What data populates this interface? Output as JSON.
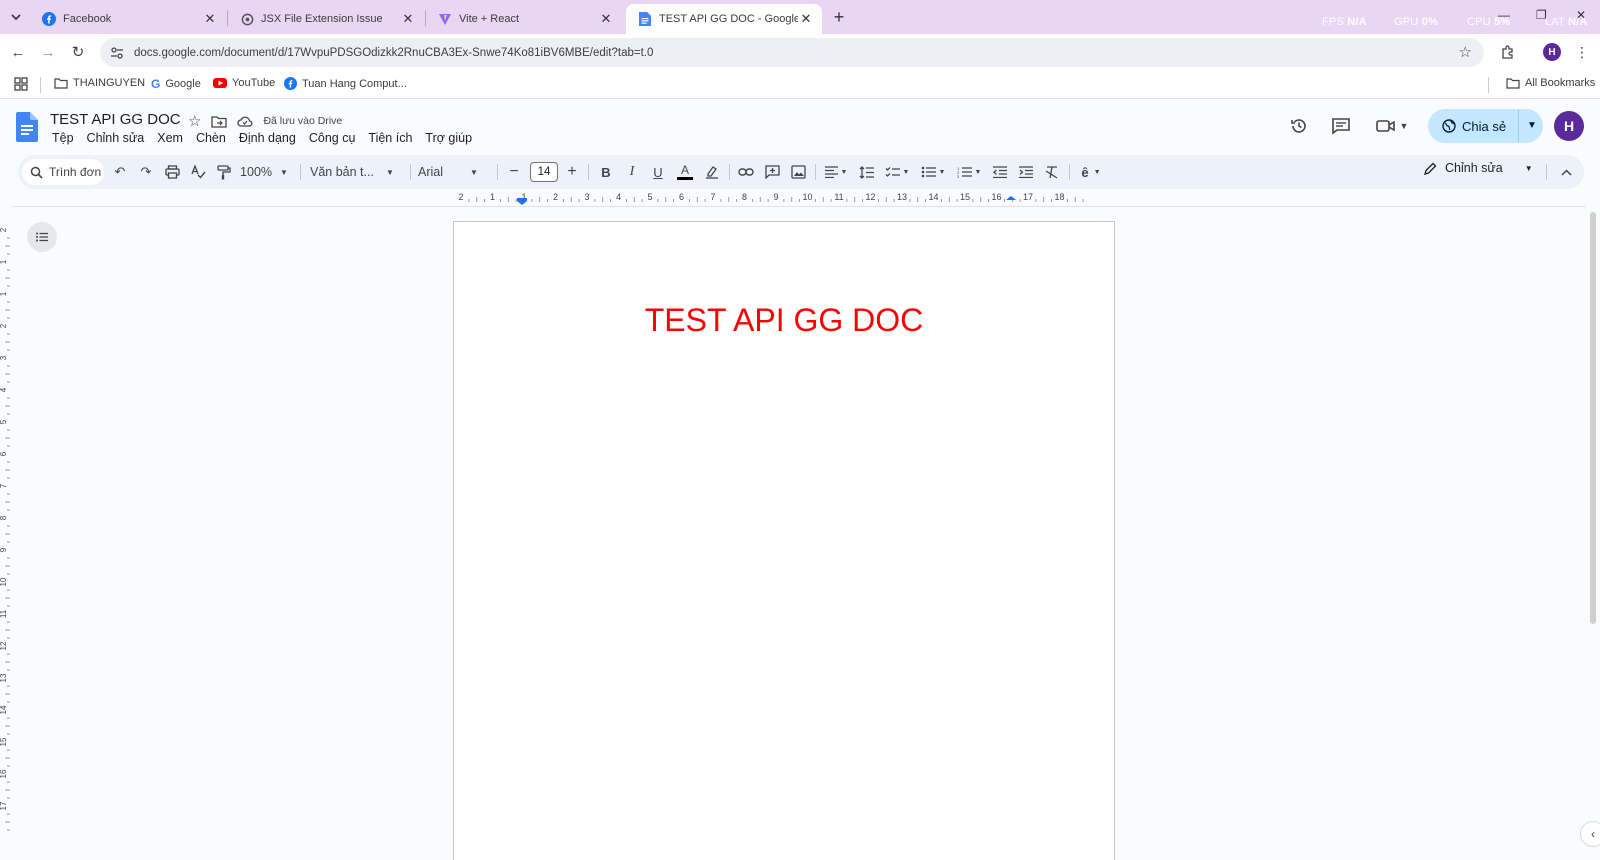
{
  "browser": {
    "tabs": [
      {
        "title": "Facebook",
        "icon": "facebook-icon",
        "active": false
      },
      {
        "title": "JSX File Extension Issue",
        "icon": "openai-icon",
        "active": false
      },
      {
        "title": "Vite + React",
        "icon": "vite-icon",
        "active": false
      },
      {
        "title": "TEST API GG DOC - Google Tài l",
        "icon": "google-docs-icon",
        "active": true
      }
    ],
    "perf": {
      "fps_label": "FPS",
      "fps_value": "N/A",
      "gpu_label": "GPU",
      "gpu_value": "0%",
      "cpu_label": "CPU",
      "cpu_value": "5%",
      "lat_label": "LAT",
      "lat_value": "N/A"
    },
    "url": "docs.google.com/document/d/17WvpuPDSGOdizkk2RnuCBA3Ex-Snwe74Ko81iBV6MBE/edit?tab=t.0",
    "profile_initial": "H",
    "bookmarks": [
      {
        "label": "THAINGUYEN",
        "icon": "folder-icon"
      },
      {
        "label": "Google",
        "icon": "google-icon"
      },
      {
        "label": "YouTube",
        "icon": "youtube-icon"
      },
      {
        "label": "Tuan Hang Comput...",
        "icon": "facebook-icon"
      }
    ],
    "all_bookmarks": "All Bookmarks"
  },
  "docs": {
    "title": "TEST API GG DOC",
    "saved_status": "Đã lưu vào Drive",
    "menu": [
      "Tệp",
      "Chỉnh sửa",
      "Xem",
      "Chèn",
      "Định dạng",
      "Công cụ",
      "Tiện ích",
      "Trợ giúp"
    ],
    "share_label": "Chia sẻ",
    "avatar_initial": "H"
  },
  "toolbar": {
    "search_label": "Trình đơn",
    "zoom": "100%",
    "style": "Văn bản t...",
    "font": "Arial",
    "font_size": "14",
    "mode": "Chỉnh sửa"
  },
  "ruler": {
    "h_labels": [
      "2",
      "1",
      "1",
      "2",
      "3",
      "4",
      "5",
      "6",
      "7",
      "8",
      "9",
      "10",
      "11",
      "12",
      "13",
      "14",
      "15",
      "16",
      "17",
      "18"
    ],
    "v_labels": [
      "2",
      "1",
      "1",
      "2",
      "3",
      "4",
      "5",
      "6",
      "7",
      "8",
      "9",
      "10",
      "11",
      "12",
      "13",
      "14",
      "15",
      "16",
      "17"
    ]
  },
  "document": {
    "heading": "TEST API GG DOC",
    "heading_color": "#ff0000"
  },
  "colors": {
    "tabbar": "#e9d6f5",
    "docs_blue": "#4285f4",
    "share_bg": "#c2e7ff",
    "avatar": "#5b2a9a"
  }
}
